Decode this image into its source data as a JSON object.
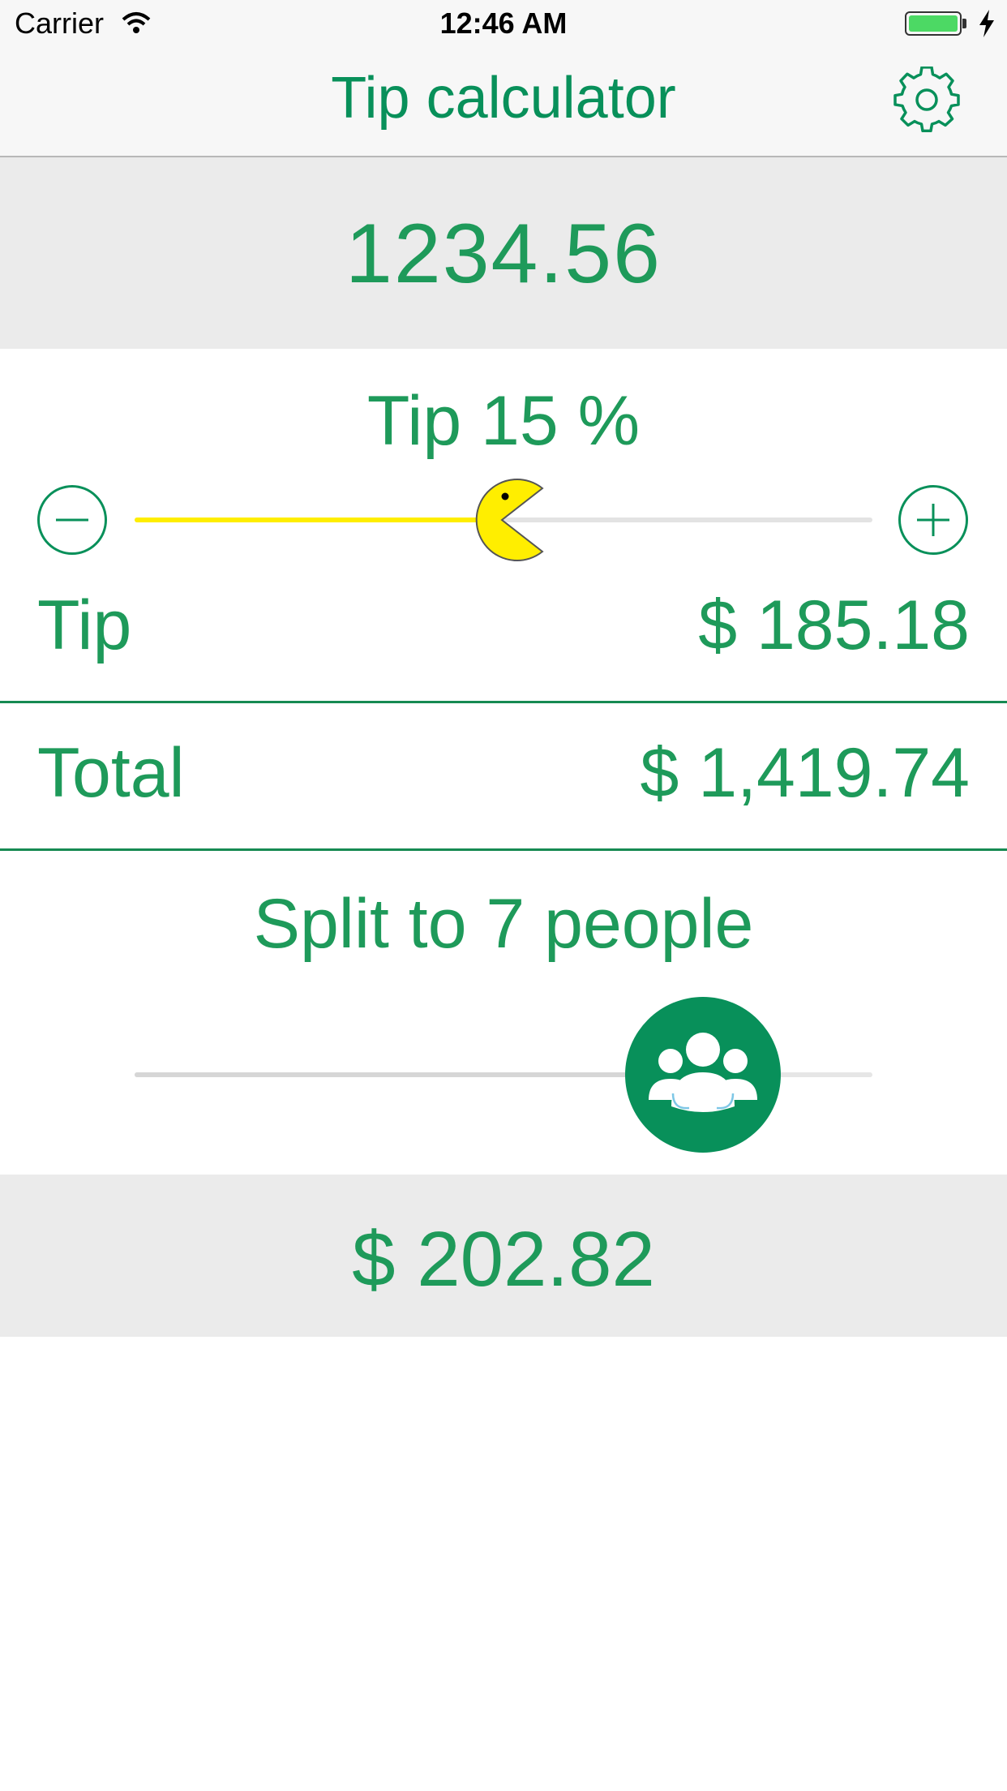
{
  "status_bar": {
    "carrier": "Carrier",
    "time": "12:46 AM"
  },
  "nav": {
    "title": "Tip calculator",
    "settings_icon": "gear-icon"
  },
  "bill": {
    "amount": "1234.56"
  },
  "tip_control": {
    "label": "Tip 15 %",
    "decrease_icon": "minus-circle-icon",
    "increase_icon": "plus-circle-icon",
    "slider_fraction": 0.5,
    "thumb_icon": "pacman-icon"
  },
  "tip_row": {
    "label": "Tip",
    "value": "$ 185.18"
  },
  "total_row": {
    "label": "Total",
    "value": "$ 1,419.74"
  },
  "split_control": {
    "label": "Split to 7 people",
    "slider_fraction": 0.77,
    "thumb_icon": "group-people-icon"
  },
  "per_person": {
    "value": "$ 202.82"
  },
  "colors": {
    "accent": "#08905a",
    "text_green": "#1e9a5a",
    "tip_fill": "#ffee00",
    "panel_bg": "#ebebeb"
  }
}
